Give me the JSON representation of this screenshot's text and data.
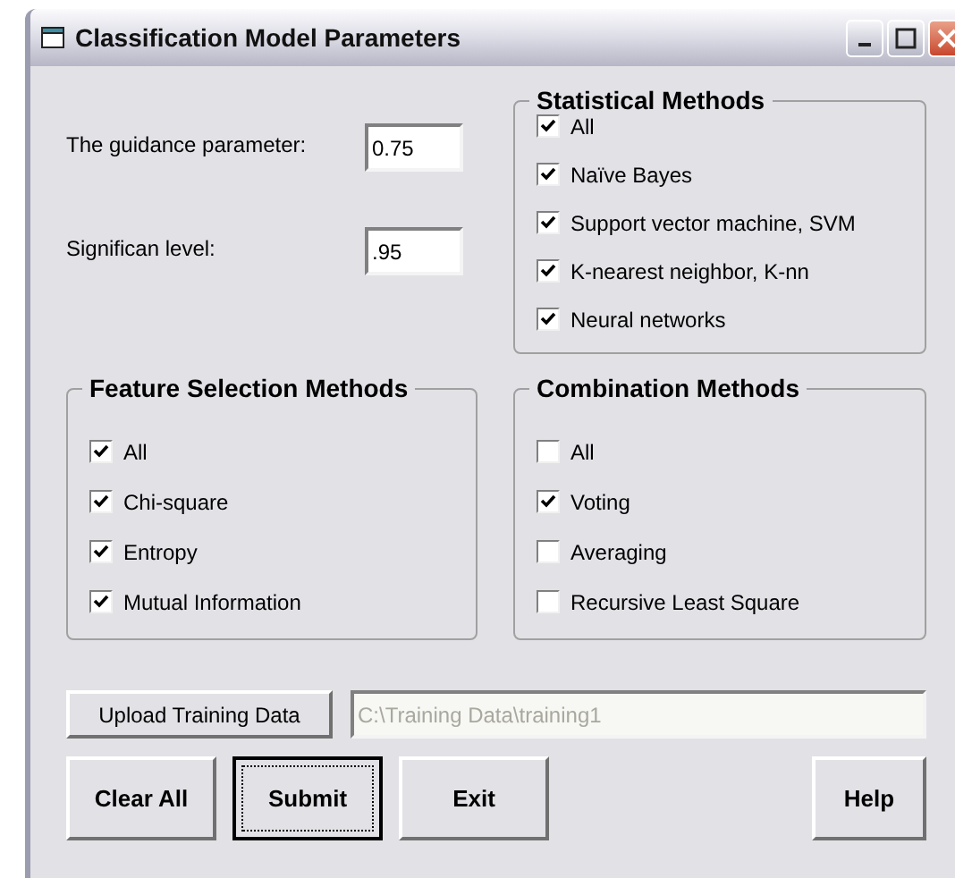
{
  "window": {
    "title": "Classification Model Parameters"
  },
  "parameters": [
    {
      "label": "The guidance parameter:",
      "value": "0.75"
    },
    {
      "label": "Significan level:",
      "value": ".95"
    }
  ],
  "statistical_methods": {
    "title": "Statistical Methods",
    "options": [
      {
        "label": "All",
        "checked": true
      },
      {
        "label": "Naïve Bayes",
        "checked": true
      },
      {
        "label": "Support vector machine, SVM",
        "checked": true
      },
      {
        "label": "K-nearest neighbor, K-nn",
        "checked": true
      },
      {
        "label": "Neural networks",
        "checked": true
      }
    ]
  },
  "feature_selection_methods": {
    "title": "Feature Selection Methods",
    "options": [
      {
        "label": "All",
        "checked": true
      },
      {
        "label": "Chi-square",
        "checked": true
      },
      {
        "label": "Entropy",
        "checked": true
      },
      {
        "label": "Mutual Information",
        "checked": true
      }
    ]
  },
  "combination_methods": {
    "title": "Combination Methods",
    "options": [
      {
        "label": "All",
        "checked": false
      },
      {
        "label": "Voting",
        "checked": true
      },
      {
        "label": "Averaging",
        "checked": false
      },
      {
        "label": "Recursive Least Square",
        "checked": false
      }
    ]
  },
  "upload": {
    "button": "Upload Training Data",
    "path": "C:\\Training Data\\training1",
    "disabled": true
  },
  "buttons": [
    {
      "label": "Clear All",
      "focused": false
    },
    {
      "label": "Submit",
      "focused": true
    },
    {
      "label": "Exit",
      "focused": false
    },
    {
      "label": "Help",
      "focused": false
    }
  ]
}
